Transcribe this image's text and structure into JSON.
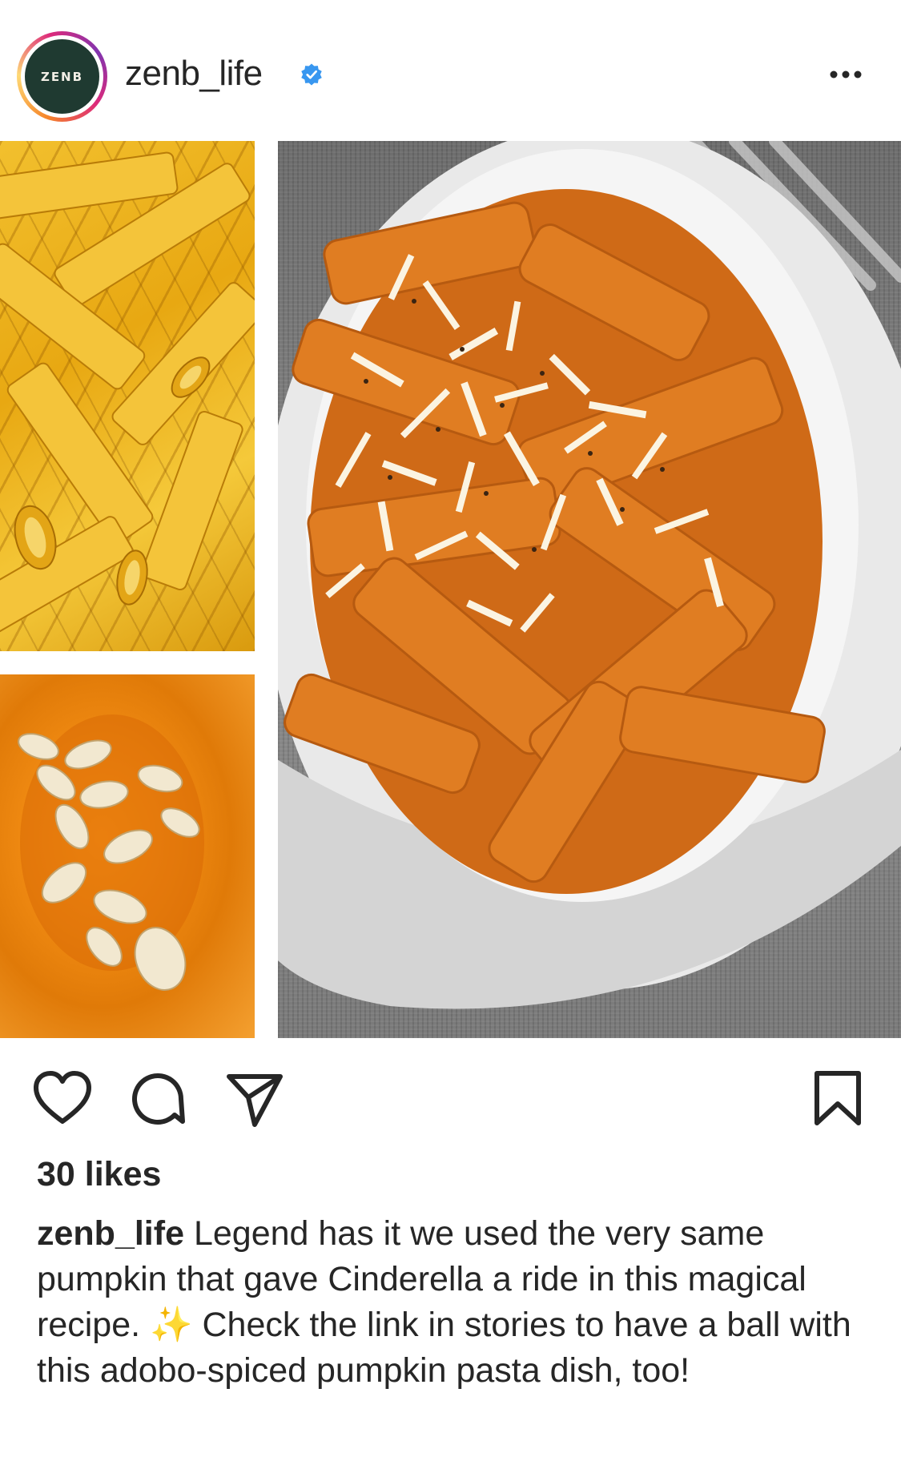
{
  "post": {
    "author": {
      "avatar_text": "ZENB",
      "username": "zenb_life",
      "verified": true
    },
    "likes_text": "30 likes",
    "caption": {
      "username": "zenb_life",
      "text": "Legend has it we used the very same pumpkin that gave Cinderella a ride in this magical recipe. ✨ Check the link in stories to have a ball with this adobo-spiced pumpkin pasta dish, too!"
    }
  },
  "icons": {
    "verified": "verified-badge-icon",
    "more": "more-options-icon",
    "like": "heart-icon",
    "comment": "comment-bubble-icon",
    "share": "paper-plane-icon",
    "save": "bookmark-icon"
  },
  "colors": {
    "verified_blue": "#3897f0",
    "text": "#262626",
    "avatar_bg": "#1f3a31",
    "pasta_yellow": "#f0b820",
    "pumpkin_orange": "#f08a12",
    "sauce_orange": "#d9731c"
  }
}
